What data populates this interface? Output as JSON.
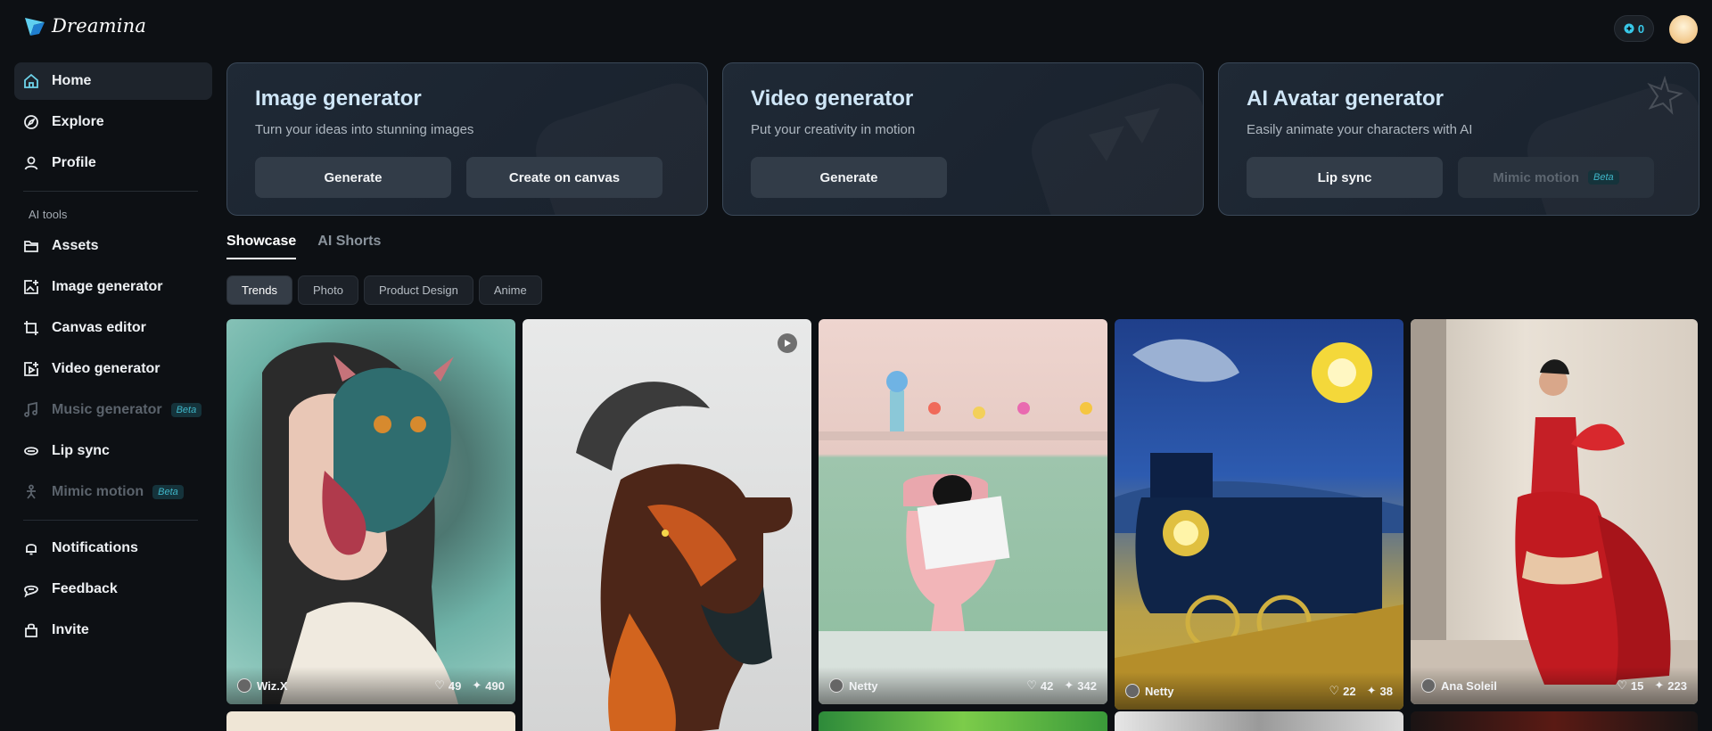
{
  "app": {
    "name": "Dreamina",
    "credits": "0"
  },
  "sidebar": {
    "main": [
      {
        "label": "Home",
        "icon": "home-icon",
        "active": true
      },
      {
        "label": "Explore",
        "icon": "compass-icon"
      },
      {
        "label": "Profile",
        "icon": "user-icon"
      }
    ],
    "tools_label": "AI tools",
    "tools": [
      {
        "label": "Assets",
        "icon": "folder-icon"
      },
      {
        "label": "Image generator",
        "icon": "image-plus-icon"
      },
      {
        "label": "Canvas editor",
        "icon": "crop-icon"
      },
      {
        "label": "Video generator",
        "icon": "video-plus-icon"
      },
      {
        "label": "Music generator",
        "icon": "music-icon",
        "beta": "Beta",
        "disabled": true
      },
      {
        "label": "Lip sync",
        "icon": "lip-sync-icon"
      },
      {
        "label": "Mimic motion",
        "icon": "mimic-icon",
        "beta": "Beta",
        "disabled": true
      }
    ],
    "footer": [
      {
        "label": "Notifications",
        "icon": "bell-icon"
      },
      {
        "label": "Feedback",
        "icon": "feedback-icon"
      },
      {
        "label": "Invite",
        "icon": "gift-icon"
      }
    ]
  },
  "cards": [
    {
      "title": "Image generator",
      "subtitle": "Turn your ideas into stunning images",
      "buttons": [
        {
          "label": "Generate"
        },
        {
          "label": "Create on canvas"
        }
      ]
    },
    {
      "title": "Video generator",
      "subtitle": "Put your creativity in motion",
      "buttons": [
        {
          "label": "Generate"
        }
      ]
    },
    {
      "title": "AI Avatar generator",
      "subtitle": "Easily animate your characters with AI",
      "buttons": [
        {
          "label": "Lip sync"
        },
        {
          "label": "Mimic motion",
          "beta": "Beta",
          "disabled": true
        }
      ]
    }
  ],
  "tabs": [
    {
      "label": "Showcase",
      "active": true
    },
    {
      "label": "AI Shorts"
    }
  ],
  "chips": [
    {
      "label": "Trends",
      "active": true
    },
    {
      "label": "Photo"
    },
    {
      "label": "Product Design"
    },
    {
      "label": "Anime"
    }
  ],
  "gallery": [
    {
      "user": "Wiz.X",
      "likes": "49",
      "remixes": "490",
      "desc": "dragon-mask-portrait"
    },
    {
      "user": "",
      "likes": "",
      "remixes": "",
      "desc": "goat-ink-art",
      "video": true
    },
    {
      "user": "Netty",
      "likes": "42",
      "remixes": "342",
      "desc": "cat-reading-newspaper"
    },
    {
      "user": "Netty",
      "likes": "22",
      "remixes": "38",
      "desc": "starry-night-train"
    },
    {
      "user": "Ana Soleil",
      "likes": "15",
      "remixes": "223",
      "desc": "red-ruffled-gown"
    }
  ],
  "colors": {
    "accent": "#38c8e8",
    "beta": "#3fb6c8",
    "bg": "#0d1014",
    "card_border": "#3a4858"
  }
}
